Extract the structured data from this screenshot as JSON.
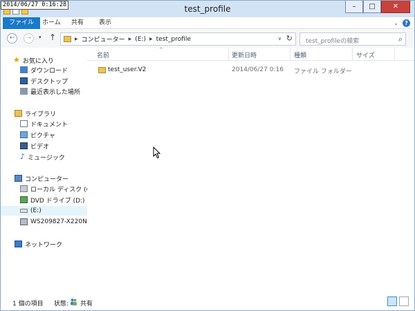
{
  "overlay": {
    "timestamp": "2014/06/27 0:16:28"
  },
  "window": {
    "title": "test_profile",
    "buttons": {
      "minimize": "–",
      "maximize": "□",
      "close": "✕"
    }
  },
  "ribbon": {
    "tabs": [
      "ファイル",
      "ホーム",
      "共有",
      "表示"
    ],
    "expand_icon": "chevron-down-icon",
    "help_label": "?"
  },
  "nav": {
    "back": "←",
    "forward": "→",
    "dropdown": "▾",
    "up": "↑",
    "breadcrumbs": [
      "コンピューター",
      "(E:)",
      "test_profile"
    ],
    "address_dropdown": "∨",
    "refresh": "↻",
    "search_placeholder": "test_profileの検索",
    "search_icon": "⌕"
  },
  "sidebar": {
    "favorites": {
      "label": "お気に入り",
      "items": [
        "ダウンロード",
        "デスクトップ",
        "最近表示した場所"
      ]
    },
    "libraries": {
      "label": "ライブラリ",
      "items": [
        "ドキュメント",
        "ピクチャ",
        "ビデオ",
        "ミュージック"
      ]
    },
    "computer": {
      "label": "コンピューター",
      "items": [
        "ローカル ディスク (C:)",
        "DVD ドライブ (D:) H",
        "(E:)",
        "WS209827-X220N"
      ]
    },
    "network": {
      "label": "ネットワーク"
    }
  },
  "columns": [
    "名前",
    "更新日時",
    "種類",
    "サイズ"
  ],
  "sort_indicator": "^",
  "files": [
    {
      "name": "test_user.V2",
      "modified": "2014/06/27 0:16",
      "type": "ファイル フォルダー",
      "size": ""
    }
  ],
  "status": {
    "count": "1 個の項目",
    "state_label": "状態:",
    "state_value": "共有"
  },
  "colors": {
    "file_tab": "#1979ca",
    "close_button": "#c7423a",
    "titlebar": "#d2e3f5",
    "selected": "#e5f3fb"
  }
}
